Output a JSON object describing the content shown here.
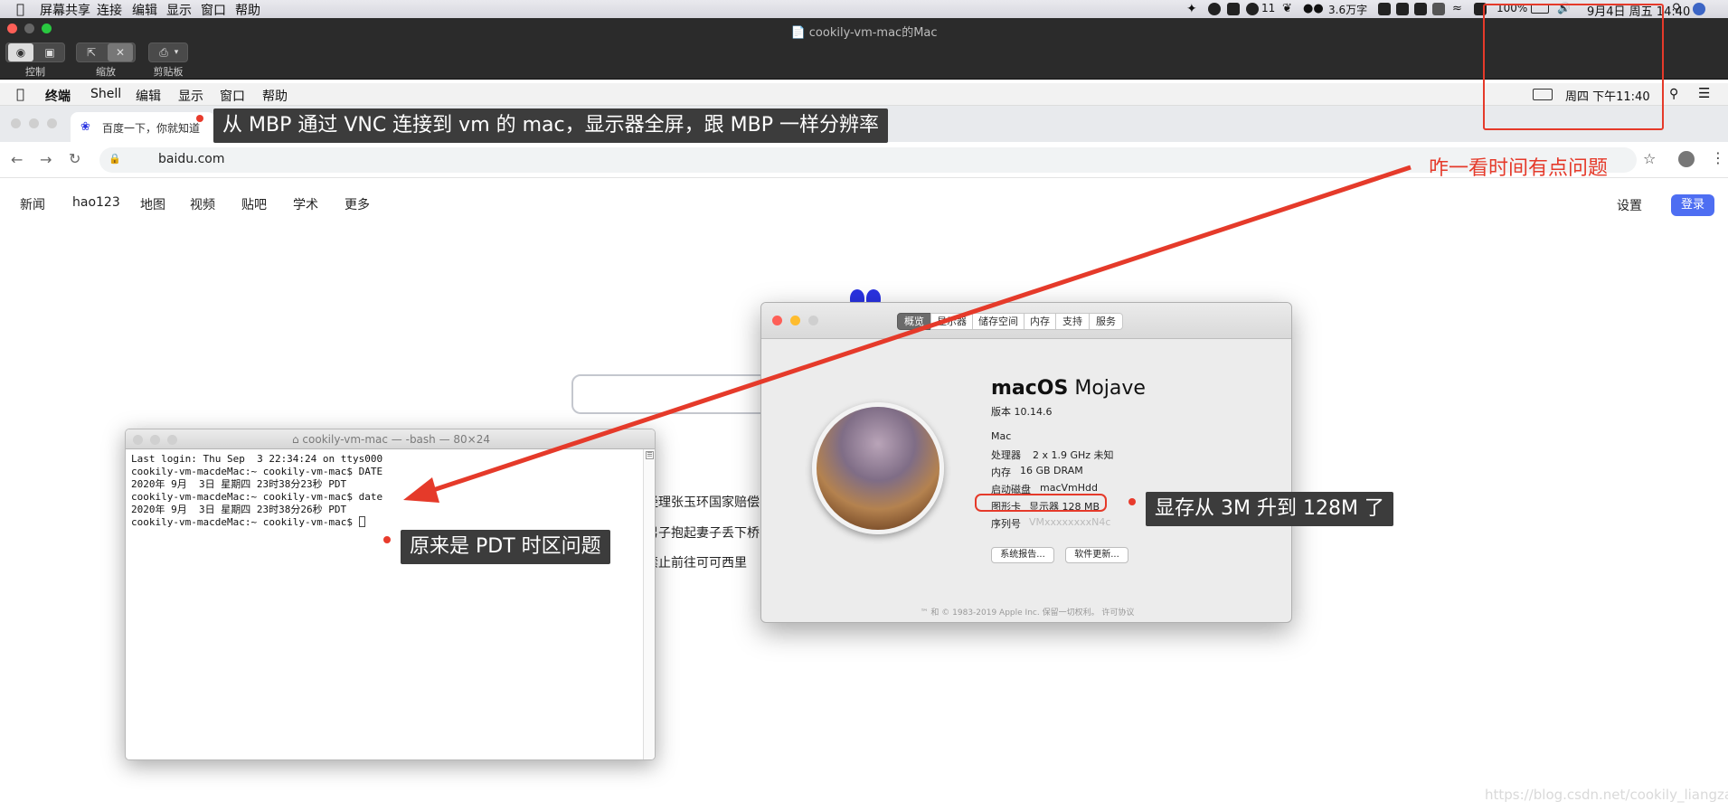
{
  "host_menubar": {
    "items": [
      "屏幕共享",
      "连接",
      "编辑",
      "显示",
      "窗口",
      "帮助"
    ],
    "status": {
      "speed": "3.6万字",
      "badge_count": "11",
      "battery": "100%",
      "datetime": "9月4日 周五 14:40"
    }
  },
  "vnc": {
    "title": "cookily-vm-mac的Mac",
    "groups": [
      {
        "label": "控制"
      },
      {
        "label": "缩放"
      },
      {
        "label": "剪贴板"
      }
    ]
  },
  "guest_menubar": {
    "items": [
      "终端",
      "Shell",
      "编辑",
      "显示",
      "窗口",
      "帮助"
    ],
    "datetime": "周四 下午11:40"
  },
  "browser": {
    "tab_title": "百度一下，你就知道",
    "url": "baidu.com",
    "nav": [
      "新闻",
      "hao123",
      "地图",
      "视频",
      "贴吧",
      "学术",
      "更多"
    ],
    "settings": "设置",
    "login": "登录",
    "hot": [
      "经理张玉环国家赔偿",
      "男子抱起妻子丢下桥",
      "禁止前往可可西里"
    ]
  },
  "terminal": {
    "title": "cookily-vm-mac — -bash — 80×24",
    "lines": [
      "Last login: Thu Sep  3 22:34:24 on ttys000",
      "cookily-vm-macdeMac:~ cookily-vm-mac$ DATE",
      "2020年 9月  3日 星期四 23时38分23秒 PDT",
      "cookily-vm-macdeMac:~ cookily-vm-mac$ date",
      "2020年 9月  3日 星期四 23时38分26秒 PDT",
      "cookily-vm-macdeMac:~ cookily-vm-mac$ "
    ]
  },
  "about": {
    "tabs": [
      "概览",
      "显示器",
      "储存空间",
      "内存",
      "支持",
      "服务"
    ],
    "os_name_bold": "macOS",
    "os_name_light": "Mojave",
    "version": "版本 10.14.6",
    "model": "Mac",
    "processor_label": "处理器",
    "processor": "2 x 1.9 GHz 未知",
    "memory_label": "内存",
    "memory": "16 GB DRAM",
    "disk_label": "启动磁盘",
    "disk": "macVmHdd",
    "graphics_label": "图形卡",
    "graphics": "显示器 128 MB",
    "serial_label": "序列号",
    "serial": "VMxxxxxxxxN4c",
    "btn_report": "系统报告...",
    "btn_update": "软件更新...",
    "copyright": "™ 和 © 1983-2019 Apple Inc. 保留一切权利。 许可协议"
  },
  "annotations": {
    "vnc_note": "从 MBP 通过 VNC 连接到 vm 的 mac，显示器全屏，跟 MBP 一样分辨率",
    "time_note": "咋一看时间有点问题",
    "pdt_note": "原来是 PDT 时区问题",
    "vram_note": "显存从 3M 升到 128M 了"
  },
  "watermark": "https://blog.csdn.net/cookily_liangzai",
  "colors": {
    "annotation_red": "#e53a2a",
    "callout_bg": "#3c3c3c",
    "baidu_blue": "#4e6ef2"
  }
}
